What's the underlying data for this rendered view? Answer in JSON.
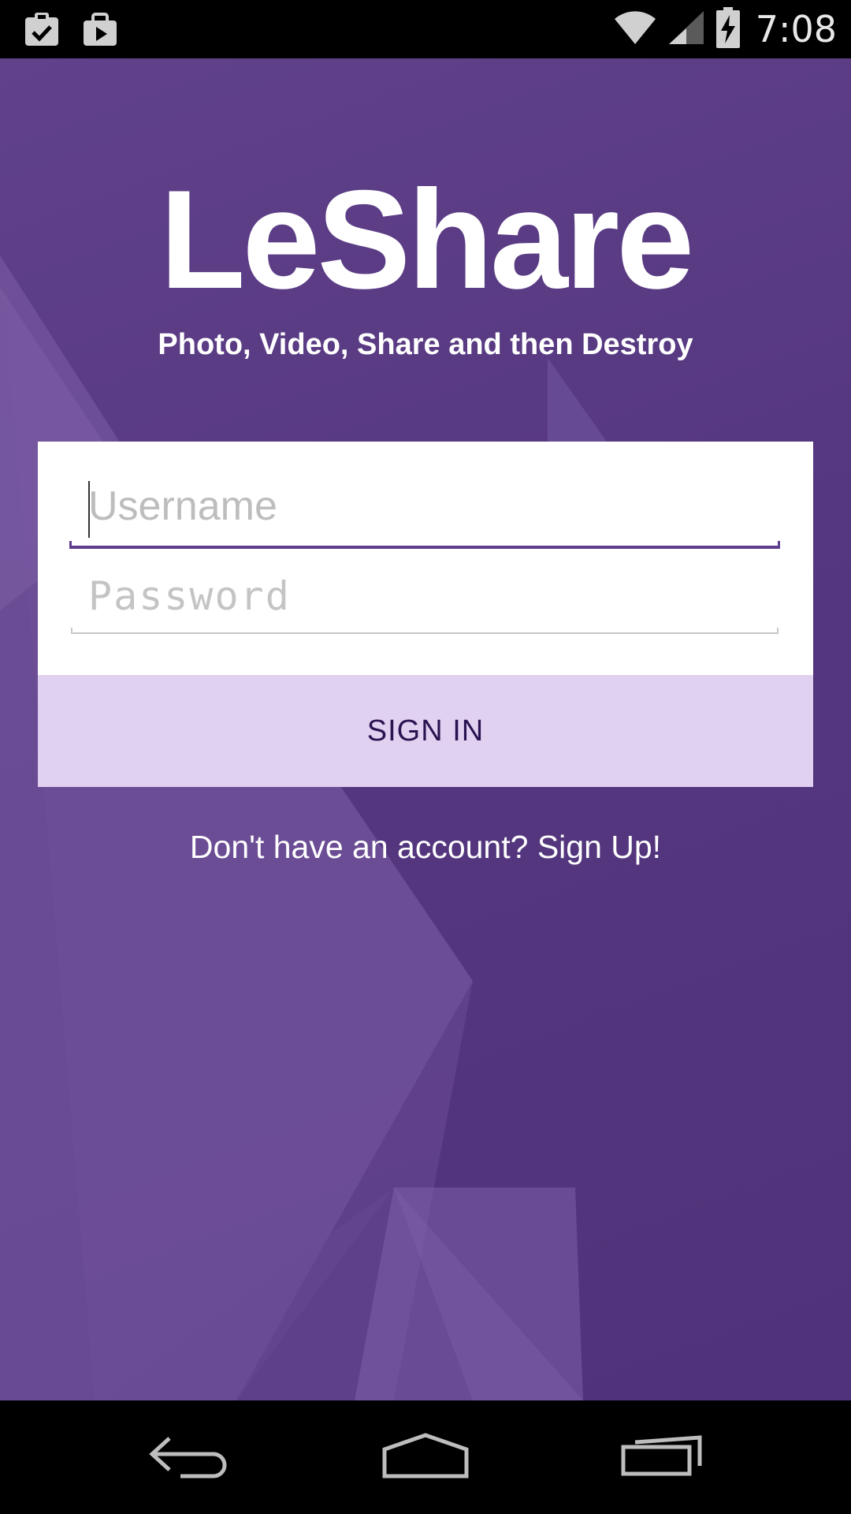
{
  "status_bar": {
    "time": "7:08",
    "left_icons": [
      "clipboard-check-icon",
      "briefcase-play-icon"
    ],
    "right_icons": [
      "wifi-icon",
      "cell-signal-icon",
      "battery-charging-icon"
    ]
  },
  "app": {
    "title": "LeShare",
    "tagline": "Photo, Video, Share and then Destroy"
  },
  "login_form": {
    "username": {
      "placeholder": "Username",
      "value": ""
    },
    "password": {
      "placeholder": "Password",
      "value": ""
    },
    "signin_label": "SIGN IN"
  },
  "signup_prompt": "Don't have an account? Sign Up!",
  "navigation": {
    "icons": [
      "back-icon",
      "home-icon",
      "recents-icon"
    ]
  },
  "colors": {
    "background": "#56387f",
    "accent": "#5f3d8d",
    "button_background": "#e1d1f1",
    "button_text": "#2a1350"
  }
}
